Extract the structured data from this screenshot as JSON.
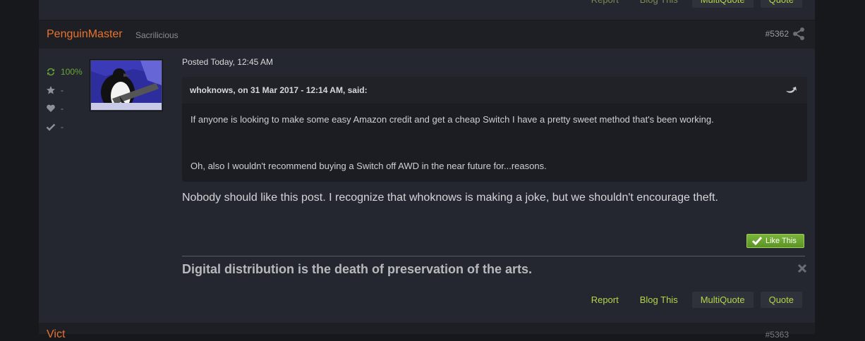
{
  "previous_post": {
    "actions": {
      "report_label": "Report",
      "blog_label": "Blog This",
      "multiquote_label": "MultiQuote",
      "quote_label": "Quote"
    }
  },
  "post": {
    "author": "PenguinMaster",
    "rank": "Sacrilicious",
    "post_number": "#5362",
    "stats": {
      "reputation": "100%",
      "stars": "-",
      "likes": "-",
      "checks": "-"
    },
    "posted": "Posted Today, 12:45 AM",
    "quote": {
      "citation": "whoknows, on 31 Mar 2017 - 12:14 AM, said:",
      "paragraphs": [
        "If anyone is looking to make some easy Amazon credit and get a cheap Switch I have a pretty sweet method that's been working.",
        "Oh, also I wouldn't recommend buying a Switch off AWD in the near future for...reasons."
      ]
    },
    "body": "Nobody should like this post. I recognize that whoknows is making a joke, but we shouldn't encourage theft.",
    "like_label": "Like This",
    "signature": "Digital distribution is the death of preservation of the arts.",
    "actions": {
      "report_label": "Report",
      "blog_label": "Blog This",
      "multiquote_label": "MultiQuote",
      "quote_label": "Quote"
    }
  },
  "next_post": {
    "author": "Vict",
    "post_number": "#5363"
  },
  "colors": {
    "accent": "#b3d64a",
    "author": "#e8732c",
    "reputation": "#6aa63a",
    "like_button": "#6aa63a"
  },
  "icons": [
    "reputation-icon",
    "star-icon",
    "heart-icon",
    "check-icon",
    "share-icon",
    "quote-jump-icon",
    "close-icon"
  ]
}
